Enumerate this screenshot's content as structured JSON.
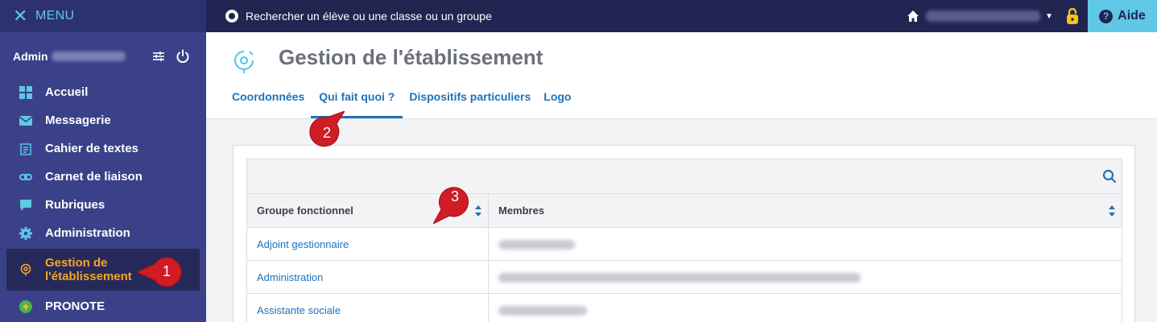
{
  "topbar": {
    "menu_label": "MENU",
    "search_label": "Rechercher un élève ou une classe ou un groupe",
    "help_label": "Aide"
  },
  "sidebar": {
    "user_prefix": "Admin",
    "items": [
      {
        "label": "Accueil",
        "icon": "dashboard-icon"
      },
      {
        "label": "Messagerie",
        "icon": "envelope-icon"
      },
      {
        "label": "Cahier de textes",
        "icon": "notebook-icon"
      },
      {
        "label": "Carnet de liaison",
        "icon": "link-icon"
      },
      {
        "label": "Rubriques",
        "icon": "chat-icon"
      },
      {
        "label": "Administration",
        "icon": "gear-icon"
      },
      {
        "label": "Gestion de l'établissement",
        "icon": "school-pin-icon",
        "active": true
      },
      {
        "label": "PRONOTE",
        "icon": "pronote-icon"
      }
    ]
  },
  "page": {
    "title": "Gestion de l'établissement",
    "tabs": [
      "Coordonnées",
      "Qui fait quoi ?",
      "Dispositifs particuliers",
      "Logo"
    ],
    "active_tab": "Qui fait quoi ?"
  },
  "table": {
    "headers": [
      "Groupe fonctionnel",
      "Membres"
    ],
    "rows": [
      "Adjoint gestionnaire",
      "Administration",
      "Assistante sociale"
    ]
  },
  "callouts": [
    "1",
    "2",
    "3"
  ],
  "colors": {
    "topbar": "#222551",
    "sidebar": "#3b4189",
    "accent_cyan": "#5ec8e5",
    "active_orange": "#f5a623",
    "link_blue": "#1f72b9",
    "callout_red": "#d01c25"
  }
}
